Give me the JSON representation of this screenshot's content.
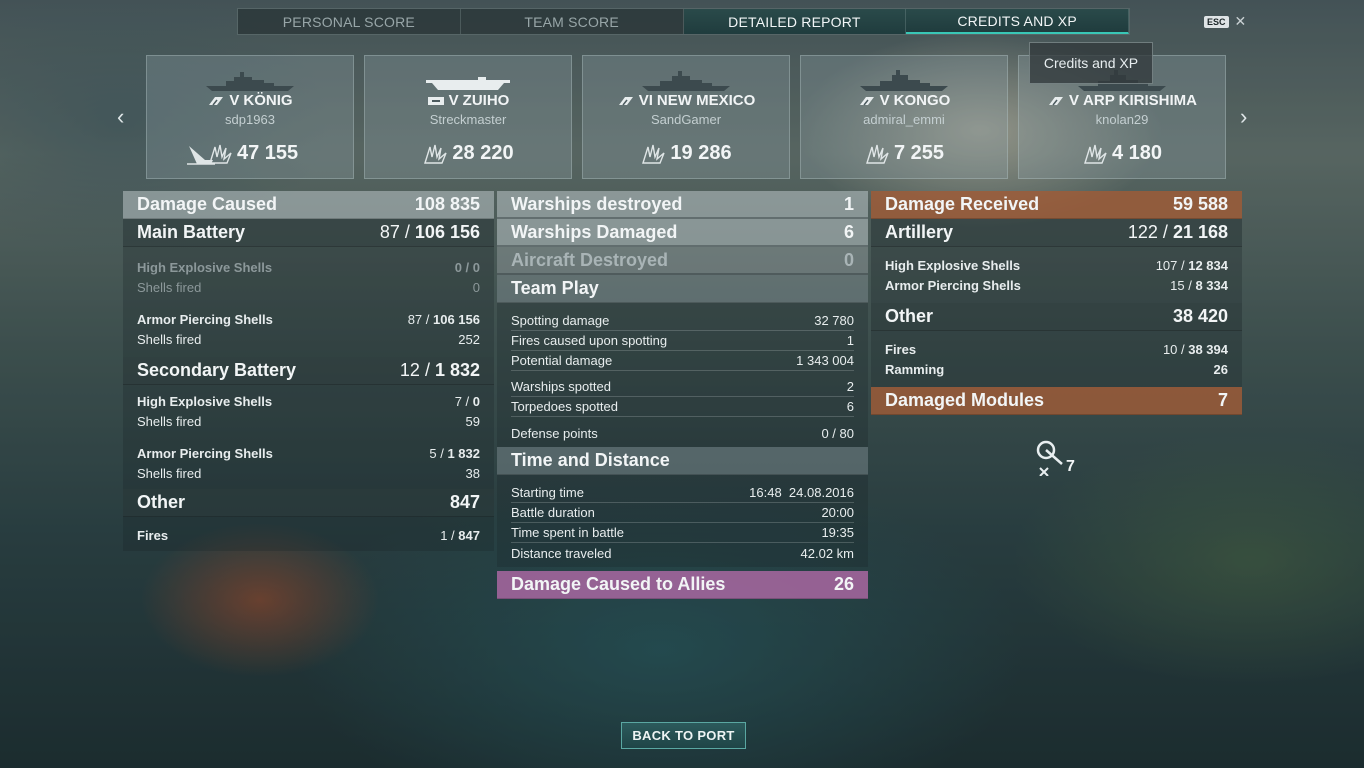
{
  "tabs": [
    {
      "label": "PERSONAL SCORE"
    },
    {
      "label": "TEAM SCORE"
    },
    {
      "label": "DETAILED REPORT"
    },
    {
      "label": "CREDITS AND XP"
    }
  ],
  "esc": {
    "key": "ESC",
    "close": "✕"
  },
  "tooltip": "Credits and XP",
  "nav": {
    "prev": "‹",
    "next": "›"
  },
  "ships": [
    {
      "tier": "V",
      "name": "KÖNIG",
      "player": "sdp1963",
      "score": "47 155",
      "type": "battleship",
      "sunk": true
    },
    {
      "tier": "V",
      "name": "ZUIHO",
      "player": "Streckmaster",
      "score": "28 220",
      "type": "carrier",
      "sunk": false
    },
    {
      "tier": "VI",
      "name": "NEW MEXICO",
      "player": "SandGamer",
      "score": "19 286",
      "type": "battleship",
      "sunk": false
    },
    {
      "tier": "V",
      "name": "KONGO",
      "player": "admiral_emmi",
      "score": "7 255",
      "type": "battleship",
      "sunk": false
    },
    {
      "tier": "V",
      "name": "ARP KIRISHIMA",
      "player": "knolan29",
      "score": "4 180",
      "type": "battleship",
      "sunk": false
    }
  ],
  "left": {
    "damage_caused": {
      "label": "Damage Caused",
      "value": "108 835"
    },
    "main_battery": {
      "label": "Main Battery",
      "a": "87 / ",
      "b": "106 156"
    },
    "mb_he": {
      "label": "High Explosive Shells",
      "value": "0 / 0"
    },
    "mb_he_fired": {
      "label": "Shells fired",
      "value": "0"
    },
    "mb_ap": {
      "label": "Armor Piercing Shells",
      "a": "87 / ",
      "b": "106 156"
    },
    "mb_ap_fired": {
      "label": "Shells fired",
      "value": "252"
    },
    "secondary": {
      "label": "Secondary Battery",
      "a": "12 / ",
      "b": "1 832"
    },
    "sb_he": {
      "label": "High Explosive Shells",
      "a": "7 / ",
      "b": "0"
    },
    "sb_he_fired": {
      "label": "Shells fired",
      "value": "59"
    },
    "sb_ap": {
      "label": "Armor Piercing Shells",
      "a": "5 / ",
      "b": "1 832"
    },
    "sb_ap_fired": {
      "label": "Shells fired",
      "value": "38"
    },
    "other": {
      "label": "Other",
      "value": "847"
    },
    "fires": {
      "label": "Fires",
      "a": "1 / ",
      "b": "847"
    }
  },
  "middle": {
    "destroyed": {
      "label": "Warships destroyed",
      "value": "1"
    },
    "damaged": {
      "label": "Warships Damaged",
      "value": "6"
    },
    "aircraft": {
      "label": "Aircraft Destroyed",
      "value": "0"
    },
    "team_play": {
      "label": "Team Play"
    },
    "spotting_damage": {
      "label": "Spotting damage",
      "value": "32 780"
    },
    "fires_spotting": {
      "label": "Fires caused upon spotting",
      "value": "1"
    },
    "potential": {
      "label": "Potential damage",
      "value": "1 343 004"
    },
    "ships_spotted": {
      "label": "Warships spotted",
      "value": "2"
    },
    "torps_spotted": {
      "label": "Torpedoes spotted",
      "value": "6"
    },
    "defense": {
      "label": "Defense points",
      "value": "0 / 80"
    },
    "time_distance": {
      "label": "Time and Distance"
    },
    "start": {
      "label": "Starting time",
      "value": "16:48  24.08.2016"
    },
    "duration": {
      "label": "Battle duration",
      "value": "20:00"
    },
    "time_spent": {
      "label": "Time spent in battle",
      "value": "19:35"
    },
    "distance": {
      "label": "Distance traveled",
      "value": "42.02 km"
    },
    "allies": {
      "label": "Damage Caused to Allies",
      "value": "26"
    }
  },
  "right": {
    "received": {
      "label": "Damage Received",
      "value": "59 588"
    },
    "artillery": {
      "label": "Artillery",
      "a": "122 / ",
      "b": "21 168"
    },
    "he": {
      "label": "High Explosive Shells",
      "a": "107 / ",
      "b": "12 834"
    },
    "ap": {
      "label": "Armor Piercing Shells",
      "a": "15 / ",
      "b": "8 334"
    },
    "other": {
      "label": "Other",
      "value": "38 420"
    },
    "fires": {
      "label": "Fires",
      "a": "10 / ",
      "b": "38 394"
    },
    "ramming": {
      "label": "Ramming",
      "value": "26"
    },
    "modules": {
      "label": "Damaged Modules",
      "value": "7"
    },
    "module_count": "7"
  },
  "back_button": "BACK TO PORT",
  "colors": {
    "accent": "#39c7b6",
    "received": "#a05c37",
    "allies": "#af69a5"
  }
}
